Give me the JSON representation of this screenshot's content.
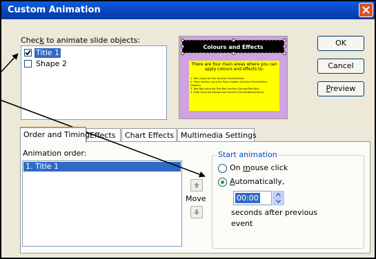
{
  "dialog": {
    "title": "Custom Animation",
    "close_icon": "close-x-icon"
  },
  "objects": {
    "label_pre": "Chec",
    "label_key": "k",
    "label_post": " to animate slide objects:",
    "items": [
      {
        "label": "Title 1",
        "checked": true,
        "selected": true
      },
      {
        "label": "Shape 2",
        "checked": false,
        "selected": false
      }
    ]
  },
  "preview": {
    "title": "Colours and Effects",
    "body_text": "There are four main areas where you can apply colours and effects to:",
    "bullets": [
      "1. Text using the Font function (Format/Font)",
      "2. Place Holders using the Place Holders function (Format/Place Holders)",
      "3. Text Box using the Text Box function (Format/Text Box)",
      "4. Slide using the Background function (Format/Background)"
    ]
  },
  "buttons": {
    "ok": "OK",
    "cancel": "Cancel",
    "preview_key": "P",
    "preview_rest": "review"
  },
  "tabs": [
    {
      "label": "Order and Timing",
      "active": true
    },
    {
      "label": "Effects",
      "active": false
    },
    {
      "label": "Chart Effects",
      "active": false
    },
    {
      "label": "Multimedia Settings",
      "active": false
    }
  ],
  "order": {
    "label": "Animation order:",
    "items": [
      "1. Title 1"
    ]
  },
  "move": {
    "label": "Move",
    "up_icon": "arrow-up-icon",
    "down_icon": "arrow-down-icon"
  },
  "start": {
    "legend": "Start animation",
    "mouse_pre": "On ",
    "mouse_key": "m",
    "mouse_post": "ouse click",
    "auto_key": "A",
    "auto_post": "utomatically,",
    "selected": "automatically",
    "seconds_value": "00:00",
    "seconds_line1": "seconds after previous",
    "seconds_line2": "event"
  },
  "colors": {
    "titlebar": "#0842b8",
    "selection": "#316ac5",
    "preview_background": "#cfa3e0",
    "preview_body": "#ffff00"
  }
}
